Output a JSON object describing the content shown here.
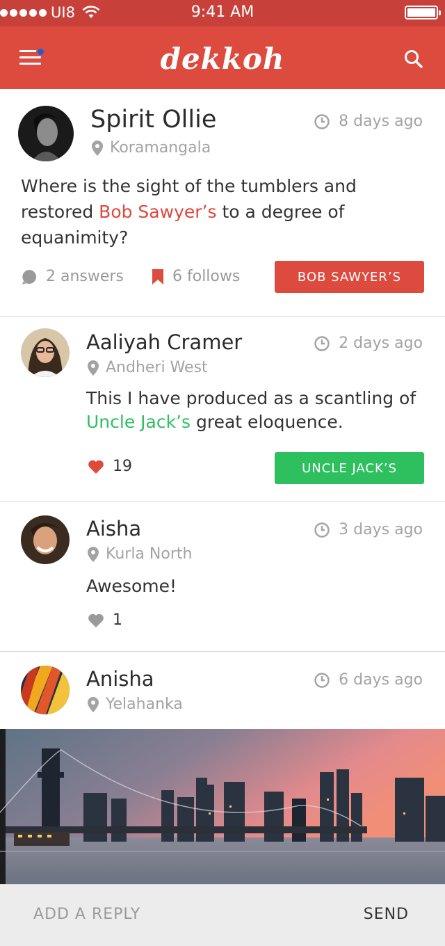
{
  "status_bar": {
    "carrier": "UI8",
    "time": "9:41 AM"
  },
  "app": {
    "title": "dekkoh",
    "accent": "#dd4a3e"
  },
  "posts": [
    {
      "author": "Spirit Ollie",
      "location": "Koramangala",
      "time_ago": "8 days ago",
      "text_before": "Where is the sight of the tumblers and restored ",
      "highlight": "Bob Sawyer’s",
      "text_after": " to a degree of equanimity?",
      "answers": "2 answers",
      "follows": "6 follows",
      "tag": "BOB SAWYER’S",
      "tag_color": "#dd4a3e"
    },
    {
      "author": "Aaliyah Cramer",
      "location": "Andheri West",
      "time_ago": "2 days ago",
      "text_before": "This I have produced as a scantling of ",
      "highlight": "Uncle Jack’s",
      "text_after": " great eloquence.",
      "likes": "19",
      "tag": "UNCLE JACK’S",
      "tag_color": "#2ec05e"
    },
    {
      "author": "Aisha",
      "location": "Kurla North",
      "time_ago": "3 days ago",
      "text": "Awesome!",
      "likes": "1"
    },
    {
      "author": "Anisha",
      "location": "Yelahanka",
      "time_ago": "6 days ago"
    }
  ],
  "reply": {
    "placeholder": "ADD A REPLY",
    "send_label": "SEND"
  }
}
